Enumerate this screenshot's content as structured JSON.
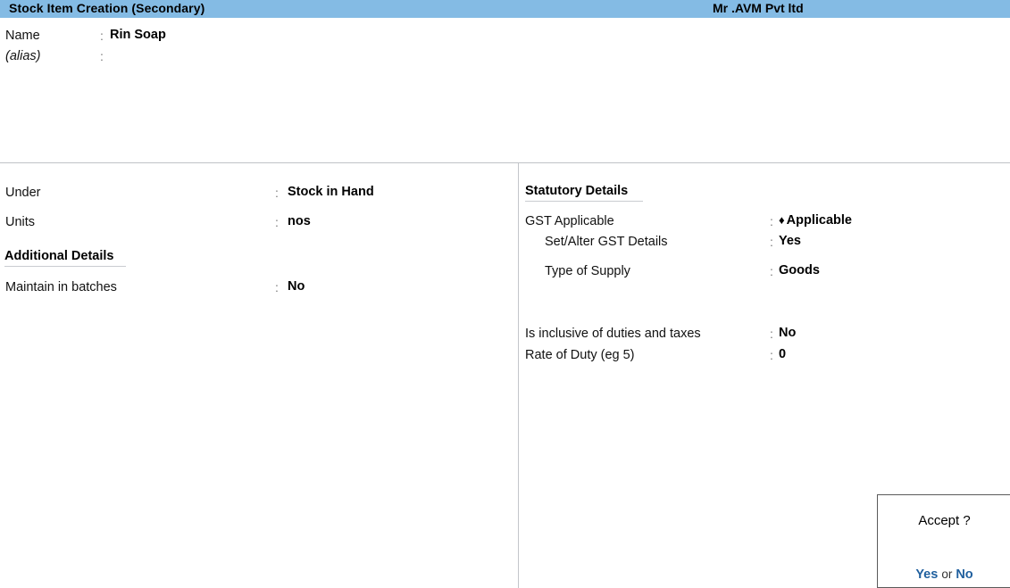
{
  "titlebar": {
    "app_title": "Stock Item Creation (Secondary)",
    "company_name": "Mr .AVM  Pvt ltd",
    "background_color": "#84BBE4"
  },
  "name_block": {
    "name_label": "Name",
    "name_colon": ":",
    "name_value": "Rin Soap",
    "alias_label": "(alias)",
    "alias_colon": ":",
    "alias_value": ""
  },
  "left_column": {
    "under": {
      "label": "Under",
      "colon": ":",
      "value": "Stock in Hand"
    },
    "units": {
      "label": "Units",
      "colon": ":",
      "value": "nos"
    },
    "additional_details_heading": "Additional Details",
    "maintain_in_batches": {
      "label": "Maintain in batches",
      "colon": ":",
      "value": "No"
    }
  },
  "right_column": {
    "statutory_details_heading": "Statutory Details",
    "gst_applicable": {
      "label": "GST Applicable",
      "colon": ":",
      "bullet": "♦",
      "value": "Applicable"
    },
    "set_alter_gst_details": {
      "label": "Set/Alter GST Details",
      "colon": ":",
      "value": "Yes"
    },
    "type_of_supply": {
      "label": "Type of Supply",
      "colon": ":",
      "value": "Goods"
    },
    "is_inclusive_of_duties_and_taxes": {
      "label": "Is inclusive of duties and taxes",
      "colon": ":",
      "value": "No"
    },
    "rate_of_duty": {
      "label": "Rate of Duty (eg 5)",
      "colon": ":",
      "value": "0"
    }
  },
  "accept_dialog": {
    "title": "Accept ?",
    "yes_label": "Yes",
    "or_label": "or",
    "no_label": "No",
    "link_color": "#1F5F9E"
  }
}
